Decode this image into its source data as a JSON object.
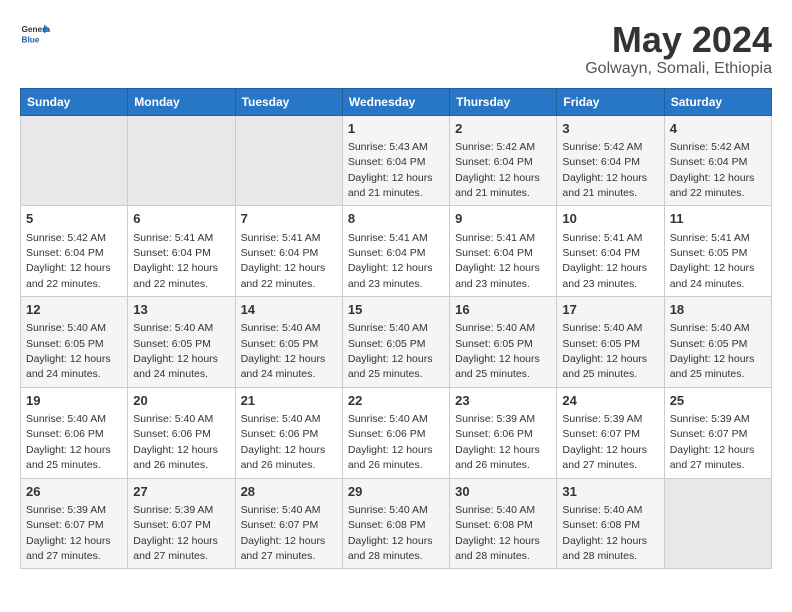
{
  "logo": {
    "line1": "General",
    "line2": "Blue"
  },
  "title": "May 2024",
  "subtitle": "Golwayn, Somali, Ethiopia",
  "days_header": [
    "Sunday",
    "Monday",
    "Tuesday",
    "Wednesday",
    "Thursday",
    "Friday",
    "Saturday"
  ],
  "weeks": [
    [
      {
        "day": "",
        "sunrise": "",
        "sunset": "",
        "daylight": "",
        "empty": true
      },
      {
        "day": "",
        "sunrise": "",
        "sunset": "",
        "daylight": "",
        "empty": true
      },
      {
        "day": "",
        "sunrise": "",
        "sunset": "",
        "daylight": "",
        "empty": true
      },
      {
        "day": "1",
        "sunrise": "Sunrise: 5:43 AM",
        "sunset": "Sunset: 6:04 PM",
        "daylight": "Daylight: 12 hours and 21 minutes."
      },
      {
        "day": "2",
        "sunrise": "Sunrise: 5:42 AM",
        "sunset": "Sunset: 6:04 PM",
        "daylight": "Daylight: 12 hours and 21 minutes."
      },
      {
        "day": "3",
        "sunrise": "Sunrise: 5:42 AM",
        "sunset": "Sunset: 6:04 PM",
        "daylight": "Daylight: 12 hours and 21 minutes."
      },
      {
        "day": "4",
        "sunrise": "Sunrise: 5:42 AM",
        "sunset": "Sunset: 6:04 PM",
        "daylight": "Daylight: 12 hours and 22 minutes."
      }
    ],
    [
      {
        "day": "5",
        "sunrise": "Sunrise: 5:42 AM",
        "sunset": "Sunset: 6:04 PM",
        "daylight": "Daylight: 12 hours and 22 minutes."
      },
      {
        "day": "6",
        "sunrise": "Sunrise: 5:41 AM",
        "sunset": "Sunset: 6:04 PM",
        "daylight": "Daylight: 12 hours and 22 minutes."
      },
      {
        "day": "7",
        "sunrise": "Sunrise: 5:41 AM",
        "sunset": "Sunset: 6:04 PM",
        "daylight": "Daylight: 12 hours and 22 minutes."
      },
      {
        "day": "8",
        "sunrise": "Sunrise: 5:41 AM",
        "sunset": "Sunset: 6:04 PM",
        "daylight": "Daylight: 12 hours and 23 minutes."
      },
      {
        "day": "9",
        "sunrise": "Sunrise: 5:41 AM",
        "sunset": "Sunset: 6:04 PM",
        "daylight": "Daylight: 12 hours and 23 minutes."
      },
      {
        "day": "10",
        "sunrise": "Sunrise: 5:41 AM",
        "sunset": "Sunset: 6:04 PM",
        "daylight": "Daylight: 12 hours and 23 minutes."
      },
      {
        "day": "11",
        "sunrise": "Sunrise: 5:41 AM",
        "sunset": "Sunset: 6:05 PM",
        "daylight": "Daylight: 12 hours and 24 minutes."
      }
    ],
    [
      {
        "day": "12",
        "sunrise": "Sunrise: 5:40 AM",
        "sunset": "Sunset: 6:05 PM",
        "daylight": "Daylight: 12 hours and 24 minutes."
      },
      {
        "day": "13",
        "sunrise": "Sunrise: 5:40 AM",
        "sunset": "Sunset: 6:05 PM",
        "daylight": "Daylight: 12 hours and 24 minutes."
      },
      {
        "day": "14",
        "sunrise": "Sunrise: 5:40 AM",
        "sunset": "Sunset: 6:05 PM",
        "daylight": "Daylight: 12 hours and 24 minutes."
      },
      {
        "day": "15",
        "sunrise": "Sunrise: 5:40 AM",
        "sunset": "Sunset: 6:05 PM",
        "daylight": "Daylight: 12 hours and 25 minutes."
      },
      {
        "day": "16",
        "sunrise": "Sunrise: 5:40 AM",
        "sunset": "Sunset: 6:05 PM",
        "daylight": "Daylight: 12 hours and 25 minutes."
      },
      {
        "day": "17",
        "sunrise": "Sunrise: 5:40 AM",
        "sunset": "Sunset: 6:05 PM",
        "daylight": "Daylight: 12 hours and 25 minutes."
      },
      {
        "day": "18",
        "sunrise": "Sunrise: 5:40 AM",
        "sunset": "Sunset: 6:05 PM",
        "daylight": "Daylight: 12 hours and 25 minutes."
      }
    ],
    [
      {
        "day": "19",
        "sunrise": "Sunrise: 5:40 AM",
        "sunset": "Sunset: 6:06 PM",
        "daylight": "Daylight: 12 hours and 25 minutes."
      },
      {
        "day": "20",
        "sunrise": "Sunrise: 5:40 AM",
        "sunset": "Sunset: 6:06 PM",
        "daylight": "Daylight: 12 hours and 26 minutes."
      },
      {
        "day": "21",
        "sunrise": "Sunrise: 5:40 AM",
        "sunset": "Sunset: 6:06 PM",
        "daylight": "Daylight: 12 hours and 26 minutes."
      },
      {
        "day": "22",
        "sunrise": "Sunrise: 5:40 AM",
        "sunset": "Sunset: 6:06 PM",
        "daylight": "Daylight: 12 hours and 26 minutes."
      },
      {
        "day": "23",
        "sunrise": "Sunrise: 5:39 AM",
        "sunset": "Sunset: 6:06 PM",
        "daylight": "Daylight: 12 hours and 26 minutes."
      },
      {
        "day": "24",
        "sunrise": "Sunrise: 5:39 AM",
        "sunset": "Sunset: 6:07 PM",
        "daylight": "Daylight: 12 hours and 27 minutes."
      },
      {
        "day": "25",
        "sunrise": "Sunrise: 5:39 AM",
        "sunset": "Sunset: 6:07 PM",
        "daylight": "Daylight: 12 hours and 27 minutes."
      }
    ],
    [
      {
        "day": "26",
        "sunrise": "Sunrise: 5:39 AM",
        "sunset": "Sunset: 6:07 PM",
        "daylight": "Daylight: 12 hours and 27 minutes."
      },
      {
        "day": "27",
        "sunrise": "Sunrise: 5:39 AM",
        "sunset": "Sunset: 6:07 PM",
        "daylight": "Daylight: 12 hours and 27 minutes."
      },
      {
        "day": "28",
        "sunrise": "Sunrise: 5:40 AM",
        "sunset": "Sunset: 6:07 PM",
        "daylight": "Daylight: 12 hours and 27 minutes."
      },
      {
        "day": "29",
        "sunrise": "Sunrise: 5:40 AM",
        "sunset": "Sunset: 6:08 PM",
        "daylight": "Daylight: 12 hours and 28 minutes."
      },
      {
        "day": "30",
        "sunrise": "Sunrise: 5:40 AM",
        "sunset": "Sunset: 6:08 PM",
        "daylight": "Daylight: 12 hours and 28 minutes."
      },
      {
        "day": "31",
        "sunrise": "Sunrise: 5:40 AM",
        "sunset": "Sunset: 6:08 PM",
        "daylight": "Daylight: 12 hours and 28 minutes."
      },
      {
        "day": "",
        "sunrise": "",
        "sunset": "",
        "daylight": "",
        "empty": true
      }
    ]
  ]
}
